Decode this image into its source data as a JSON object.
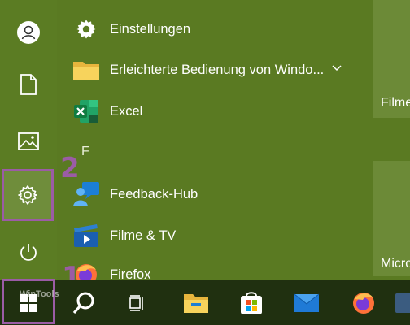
{
  "rail": {
    "items": [
      {
        "name": "account",
        "icon": "user-icon"
      },
      {
        "name": "documents",
        "icon": "document-icon"
      },
      {
        "name": "pictures",
        "icon": "image-icon"
      },
      {
        "name": "settings",
        "icon": "gear-icon"
      },
      {
        "name": "power",
        "icon": "power-icon"
      }
    ]
  },
  "apps": [
    {
      "label": "Einstellungen",
      "icon": "gear-icon"
    },
    {
      "label": "Erleichterte Bedienung von Windo...",
      "icon": "folder-icon"
    },
    {
      "label": "Excel",
      "icon": "excel-icon"
    },
    {
      "label": "Feedback-Hub",
      "icon": "feedback-hub-icon"
    },
    {
      "label": "Filme & TV",
      "icon": "movies-tv-icon"
    },
    {
      "label": "Firefox",
      "icon": "firefox-icon"
    }
  ],
  "section_letter": "F",
  "tiles": [
    {
      "label": "Filme"
    },
    {
      "label": "Micro"
    }
  ],
  "annotations": {
    "one": "1",
    "two": "2"
  },
  "watermark": "WinTools",
  "taskbar": {
    "items": [
      {
        "icon": "windows-start-icon"
      },
      {
        "icon": "search-icon"
      },
      {
        "icon": "task-view-icon"
      },
      {
        "icon": "file-explorer-icon"
      },
      {
        "icon": "microsoft-store-icon"
      },
      {
        "icon": "mail-icon"
      },
      {
        "icon": "firefox-icon"
      }
    ]
  },
  "colors": {
    "background": "#5a7a22",
    "taskbar": "#203010",
    "highlight": "#9b5ca5",
    "tile": "#6c8a37"
  }
}
